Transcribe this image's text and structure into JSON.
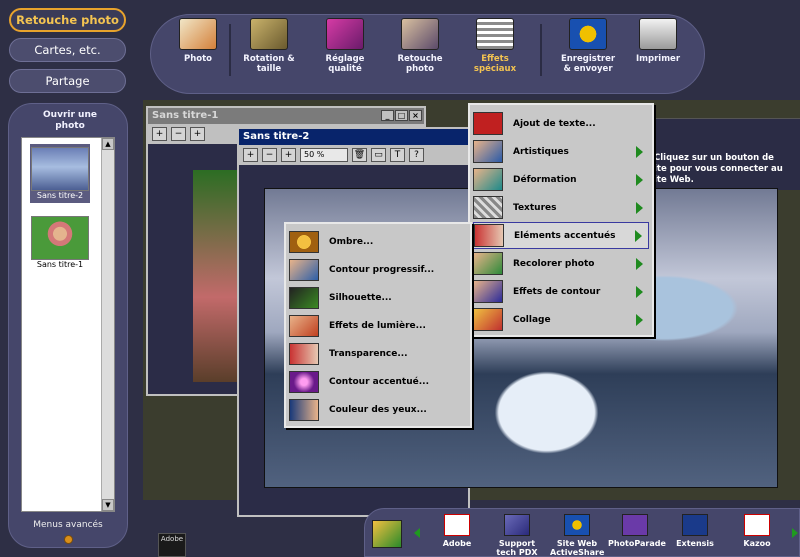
{
  "modes": [
    {
      "label": "Retouche photo",
      "active": true
    },
    {
      "label": "Cartes, etc.",
      "active": false
    },
    {
      "label": "Partage",
      "active": false
    }
  ],
  "sidebar": {
    "open_photo_label": "Ouvrir une photo",
    "thumbnails": [
      {
        "label": "Sans titre-2",
        "selected": true
      },
      {
        "label": "Sans titre-1",
        "selected": false
      }
    ],
    "advanced_menus_label": "Menus avancés"
  },
  "toolbar": {
    "items": [
      {
        "label": "Photo",
        "icon": "photo-icon"
      },
      {
        "label": "Rotation & taille",
        "icon": "rotate-icon"
      },
      {
        "label": "Réglage qualité",
        "icon": "quality-icon"
      },
      {
        "label": "Retouche photo",
        "icon": "retouch-icon"
      },
      {
        "label": "Effets spéciaux",
        "icon": "effects-icon",
        "active": true
      },
      {
        "label": "Enregistrer & envoyer",
        "icon": "save-send-icon"
      },
      {
        "label": "Imprimer",
        "icon": "print-icon"
      }
    ]
  },
  "windows": {
    "win1_title": "Sans titre-1",
    "win2_title": "Sans titre-2",
    "zoom": "50 %",
    "controls": {
      "minimize": "_",
      "maximize": "□",
      "close": "×"
    }
  },
  "toolrow": {
    "zoom_in": "+",
    "zoom_out": "−",
    "fit": "+",
    "trash": "🗑",
    "window": "▭",
    "text": "T",
    "help": "?"
  },
  "side_text": "Cliquez sur un bouton de ite Web.",
  "side_text_lines": [
    "Cliquez sur un bouton de",
    "ite pour vous connecter au",
    "ite Web."
  ],
  "effects_menu": {
    "items": [
      {
        "label": "Ajout de texte...",
        "submenu": false
      },
      {
        "label": "Artistiques",
        "submenu": true
      },
      {
        "label": "Déformation",
        "submenu": true
      },
      {
        "label": "Textures",
        "submenu": true
      },
      {
        "label": "Eléments accentués",
        "submenu": true,
        "highlighted": true
      },
      {
        "label": "Recolorer photo",
        "submenu": true
      },
      {
        "label": "Effets de contour",
        "submenu": true
      },
      {
        "label": "Collage",
        "submenu": true
      }
    ]
  },
  "submenu": {
    "items": [
      {
        "label": "Ombre..."
      },
      {
        "label": "Contour progressif..."
      },
      {
        "label": "Silhouette..."
      },
      {
        "label": "Effets de lumière..."
      },
      {
        "label": "Transparence..."
      },
      {
        "label": "Contour accentué..."
      },
      {
        "label": "Couleur des yeux..."
      }
    ]
  },
  "partners": [
    {
      "label": "Adobe"
    },
    {
      "label": "Support tech PDX"
    },
    {
      "label": "Site Web ActiveShare"
    },
    {
      "label": "PhotoParade"
    },
    {
      "label": "Extensis"
    },
    {
      "label": "Kazoo"
    }
  ],
  "adobe_logo_text": "Adobe",
  "colors": {
    "background": "#2e2f45",
    "panel": "#45466a",
    "accent": "#e8a32c",
    "menu_bg": "#c8c8c8",
    "submenu_arrow": "#1f8a1f",
    "title_bar": "#08246b"
  }
}
